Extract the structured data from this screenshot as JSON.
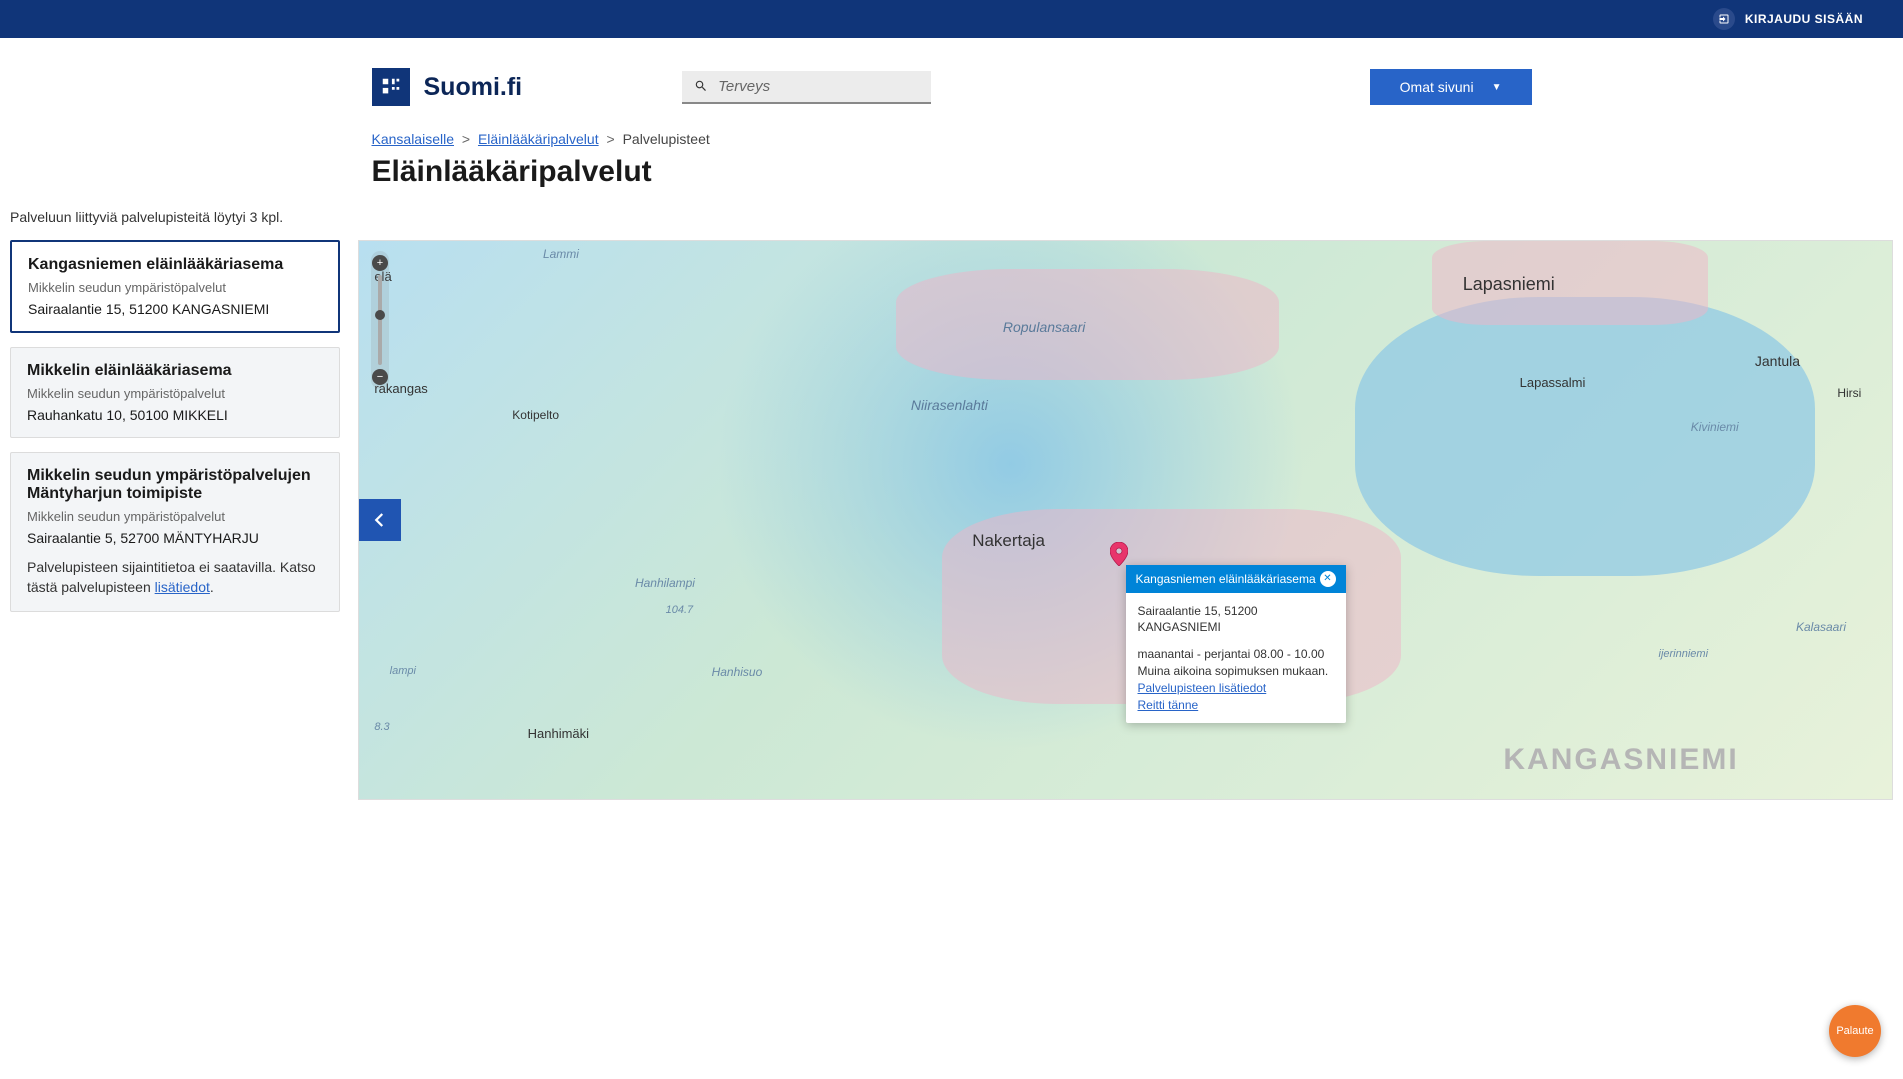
{
  "topbar": {
    "login": "KIRJAUDU SISÄÄN"
  },
  "header": {
    "logo_text": "Suomi.fi",
    "search_value": "Terveys",
    "omat_label": "Omat sivuni"
  },
  "breadcrumb": {
    "items": [
      {
        "label": "Kansalaiselle",
        "link": true
      },
      {
        "label": "Eläinlääkäripalvelut",
        "link": true
      },
      {
        "label": "Palvelupisteet",
        "link": false
      }
    ]
  },
  "page_title": "Eläinlääkäripalvelut",
  "result_count": "Palveluun liittyviä palvelupisteitä löytyi 3 kpl.",
  "cards": [
    {
      "title": "Kangasniemen eläinlääkäriasema",
      "org": "Mikkelin seudun ympäristöpalvelut",
      "addr": "Sairaalantie 15, 51200 KANGASNIEMI",
      "active": true
    },
    {
      "title": "Mikkelin eläinlääkäriasema",
      "org": "Mikkelin seudun ympäristöpalvelut",
      "addr": "Rauhankatu 10, 50100 MIKKELI",
      "active": false
    },
    {
      "title": "Mikkelin seudun ympäristöpalvelujen Mäntyharjun toimipiste",
      "org": "Mikkelin seudun ympäristöpalvelut",
      "addr": "Sairaalantie 5, 52700 MÄNTYHARJU",
      "active": false,
      "note_prefix": "Palvelupisteen sijaintitietoa ei saatavilla. Katso tästä palvelupisteen ",
      "note_link": "lisätiedot",
      "note_suffix": "."
    }
  ],
  "map": {
    "labels": {
      "lapasniemi": "Lapasniemi",
      "ropulansaari": "Ropulansaari",
      "jantula": "Jantula",
      "lapassalmi": "Lapassalmi",
      "niirasenlahti": "Niirasenlahti",
      "hirsi": "Hirsi",
      "kiviniemi": "Kiviniemi",
      "kotipelto": "Kotipelto",
      "rakangas": "rakangas",
      "nakertaja": "Nakertaja",
      "hanhilampi": "Hanhilampi",
      "depth": "104.7",
      "kalasaari": "Kalasaari",
      "ijerinniemi": "ijerinniemi",
      "lammi": "Lammi",
      "ela": "elä",
      "lampi": "lampi",
      "depth2": "8.3",
      "hanhisuo": "Hanhisuo",
      "hanhimaki": "Hanhimäki",
      "kangasniemi": "KANGASNIEMI"
    },
    "popup": {
      "title": "Kangasniemen eläinlääkäriasema",
      "addr": "Sairaalantie 15, 51200 KANGASNIEMI",
      "hours": "maanantai - perjantai 08.00 - 10.00",
      "note": "Muina aikoina sopimuksen mukaan.",
      "link1": "Palvelupisteen lisätiedot",
      "link2": "Reitti tänne"
    }
  },
  "feedback": "Palaute"
}
